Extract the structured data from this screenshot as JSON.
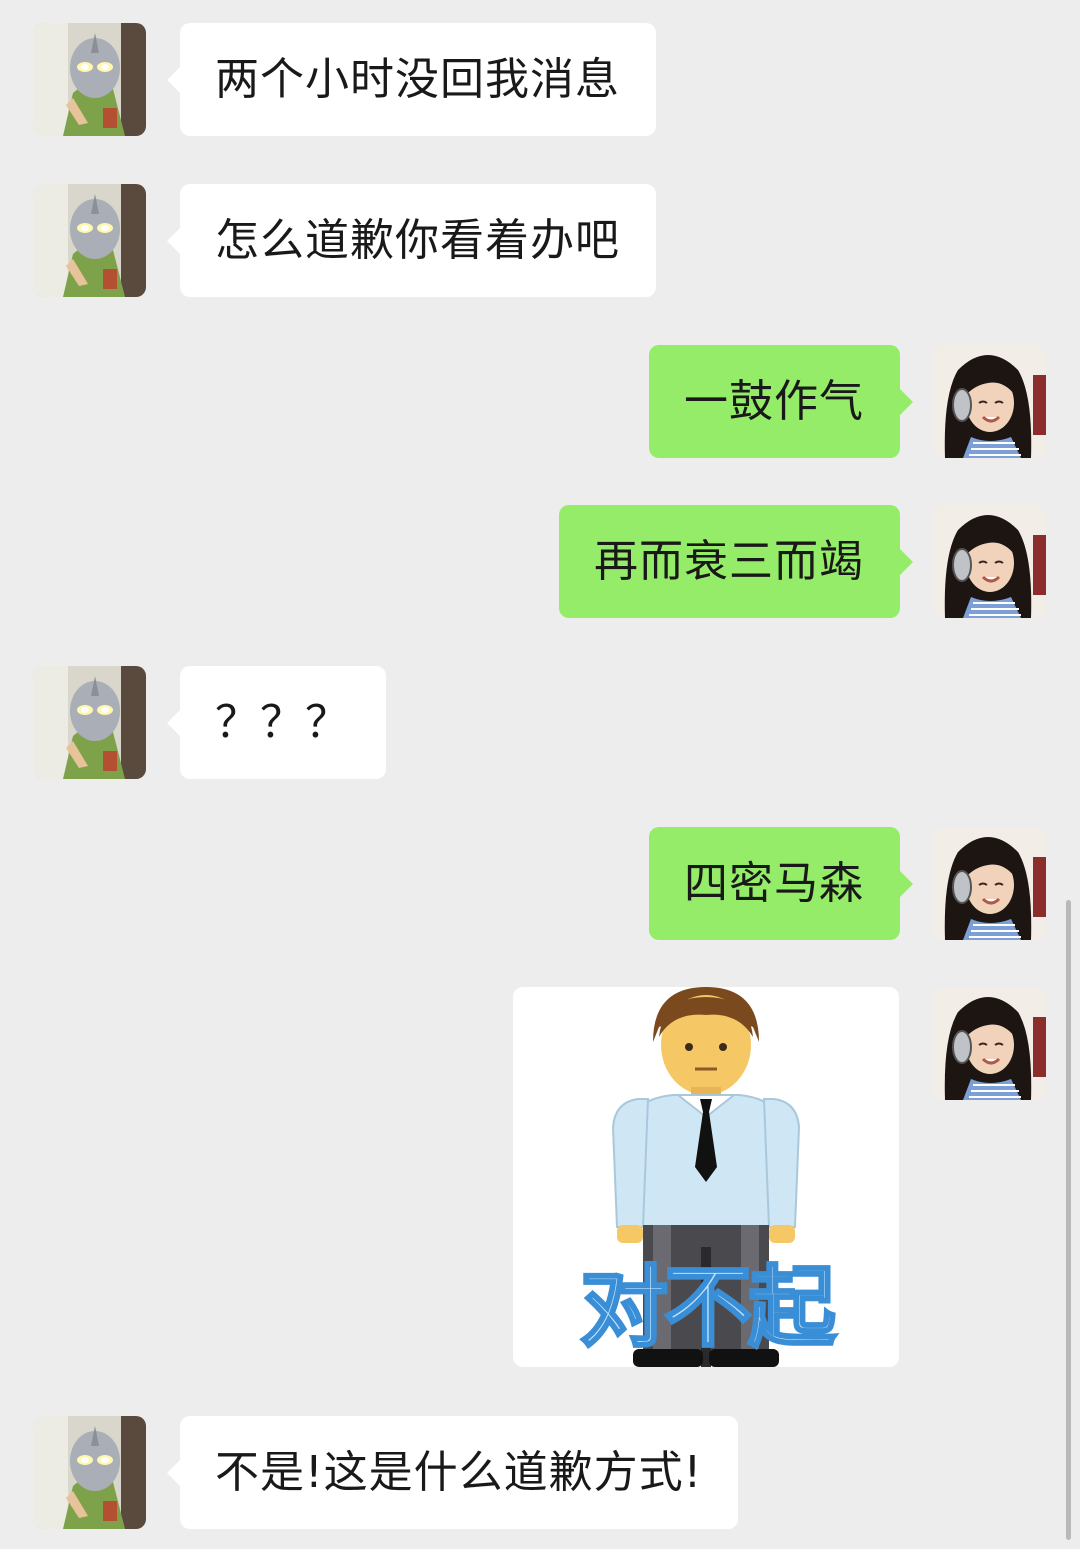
{
  "messages": [
    {
      "side": "in",
      "type": "text",
      "text": "两个小时没回我消息"
    },
    {
      "side": "in",
      "type": "text",
      "text": "怎么道歉你看着办吧"
    },
    {
      "side": "out",
      "type": "text",
      "text": "一鼓作气"
    },
    {
      "side": "out",
      "type": "text",
      "text": "再而衰三而竭"
    },
    {
      "side": "in",
      "type": "text",
      "text": "？？？"
    },
    {
      "side": "out",
      "type": "text",
      "text": "四密马森"
    },
    {
      "side": "out",
      "type": "sticker",
      "caption": "对不起"
    },
    {
      "side": "in",
      "type": "text",
      "text": "不是!这是什么道歉方式!"
    }
  ],
  "colors": {
    "background": "#ededed",
    "incoming_bubble": "#ffffff",
    "outgoing_bubble": "#95ec69"
  },
  "icons": {
    "contact_avatar": "masked-figure-avatar",
    "self_avatar": "girl-with-headphones-avatar"
  }
}
